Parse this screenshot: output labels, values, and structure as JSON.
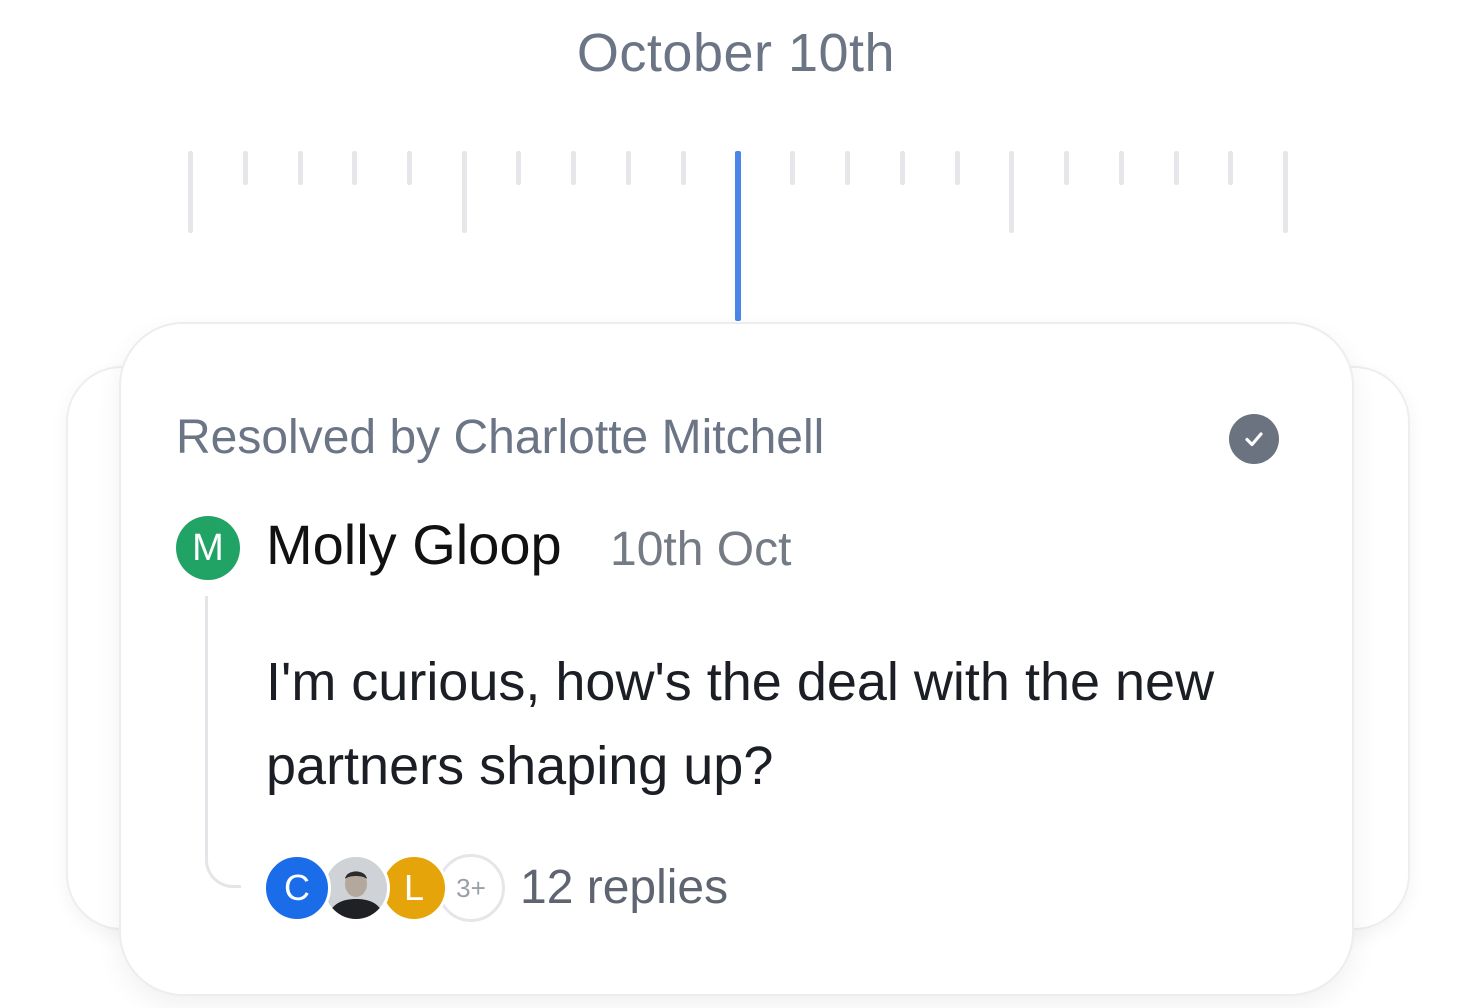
{
  "timeline": {
    "date_label": "October 10th"
  },
  "comment": {
    "resolved_text": "Resolved by Charlotte Mitchell",
    "status_icon": "check-circle-icon",
    "author": {
      "name": "Molly Gloop",
      "initial": "M",
      "avatar_color": "#22a366"
    },
    "date": "10th Oct",
    "message": "I'm curious, how's the deal with the new partners shaping up?",
    "participants": [
      {
        "initial": "C",
        "color": "#1a6ce8"
      },
      {
        "initial": "",
        "type": "photo"
      },
      {
        "initial": "L",
        "color": "#e5a50a"
      }
    ],
    "more_participants": "3+",
    "replies_label": "12 replies"
  },
  "colors": {
    "indicator": "#4a86e8",
    "tick": "#e5e7eb"
  }
}
